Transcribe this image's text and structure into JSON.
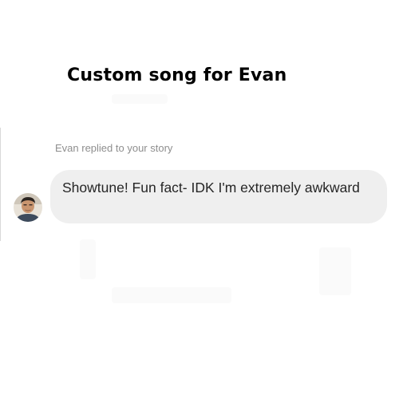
{
  "header": {
    "title": "Custom song for Evan"
  },
  "conversation": {
    "reply_caption": "Evan replied to your story",
    "message": {
      "text": "Showtune! Fun fact- IDK I'm extremely awkward"
    },
    "avatar_icon": "user-avatar-photo"
  },
  "colors": {
    "bubble_background": "#efefef",
    "caption_text": "#8e8e8e",
    "message_text": "#262626"
  }
}
